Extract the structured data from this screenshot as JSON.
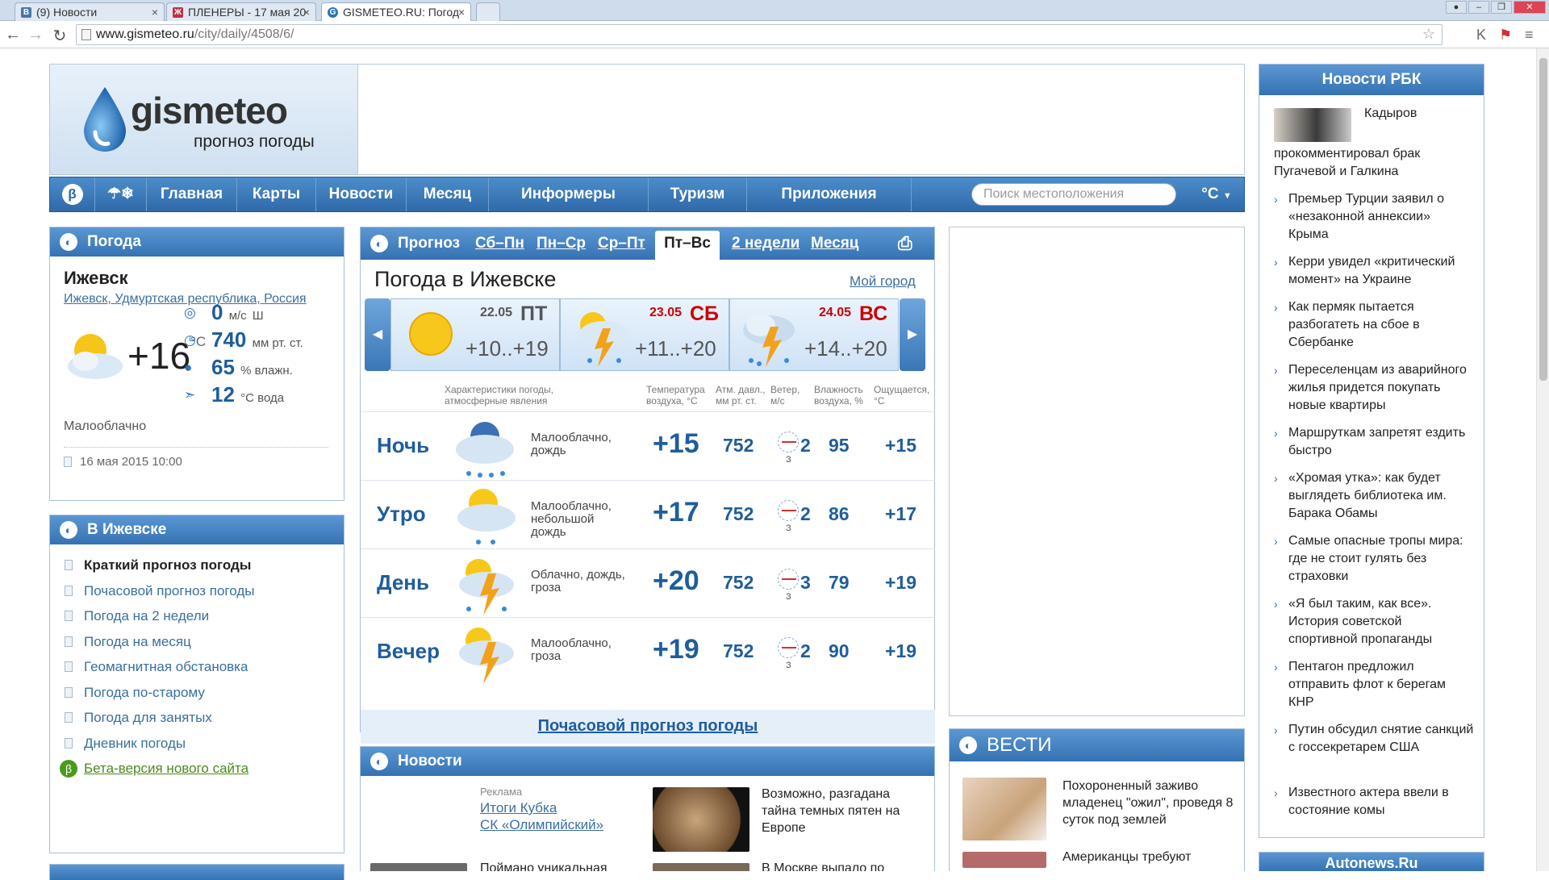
{
  "browser": {
    "tabs": [
      {
        "title": "(9) Новости",
        "favicon": "В"
      },
      {
        "title": "ПЛЕНЕРЫ - 17 мая 20",
        "favicon": "Ж"
      },
      {
        "title": "GISMETEO.RU: Погод",
        "favicon": "G"
      }
    ],
    "url_host": "www.gismeteo.ru",
    "url_path": "/city/daily/4508/6/"
  },
  "logo": {
    "name": "gismeteo",
    "tagline": "прогноз погоды"
  },
  "menu": {
    "items": [
      "Главная",
      "Карты",
      "Новости",
      "Месяц",
      "Информеры",
      "Туризм",
      "Приложения"
    ],
    "search_placeholder": "Поиск местоположения",
    "unit": "°C"
  },
  "weather_now": {
    "header": "Погода",
    "city": "Ижевск",
    "region_links": [
      "Ижевск",
      "Удмуртская республика",
      "Россия"
    ],
    "temp": "+16",
    "temp_unit": "°C",
    "condition": "Малооблачно",
    "wind_value": "0",
    "wind_unit": "м/с",
    "wind_dir": "Ш",
    "pressure_value": "740",
    "pressure_unit": "мм рт. ст.",
    "humidity_value": "65",
    "humidity_unit": "% влажн.",
    "water_value": "12",
    "water_unit": "°С вода",
    "observed": "16 мая 2015 10:00"
  },
  "in_city": {
    "header": "В Ижевске",
    "links": [
      "Краткий прогноз погоды",
      "Почасовой прогноз погоды",
      "Погода на 2 недели",
      "Погода на месяц",
      "Геомагнитная обстановка",
      "Погода по-старому",
      "Погода для занятых",
      "Дневник погоды"
    ],
    "beta": "Бета-версия нового сайта"
  },
  "forecast": {
    "header": "Прогноз",
    "tabs": [
      "Сб–Пн",
      "Пн–Ср",
      "Ср–Пт",
      "Пт–Вс",
      "2 недели",
      "Месяц"
    ],
    "title": "Погода в Ижевске",
    "my_city": "Мой город",
    "days": [
      {
        "date": "22.05",
        "name": "ПТ",
        "low": "+10",
        "high": "+19",
        "weekend": false,
        "icon": "sun-icon"
      },
      {
        "date": "23.05",
        "name": "СБ",
        "low": "+11",
        "high": "+20",
        "weekend": true,
        "icon": "thunderstorm-icon"
      },
      {
        "date": "24.05",
        "name": "ВС",
        "low": "+14",
        "high": "+20",
        "weekend": true,
        "icon": "thunderstorm-icon"
      }
    ],
    "columns": {
      "conditions": "Характеристики погоды, атмосферные явления",
      "temp": "Температура воздуха, °С",
      "pressure": "Атм. давл., мм рт. ст.",
      "wind": "Ветер, м/с",
      "humidity": "Влажность воздуха, %",
      "feels": "Ощущается, °С"
    },
    "rows": [
      {
        "period": "Ночь",
        "desc": "Малооблачно, дождь",
        "temp": "+15",
        "pressure": "752",
        "wind": "2",
        "wind_dir": "З",
        "humidity": "95",
        "feels": "+15"
      },
      {
        "period": "Утро",
        "desc": "Малооблачно, небольшой дождь",
        "temp": "+17",
        "pressure": "752",
        "wind": "2",
        "wind_dir": "З",
        "humidity": "86",
        "feels": "+17"
      },
      {
        "period": "День",
        "desc": "Облачно, дождь, гроза",
        "temp": "+20",
        "pressure": "752",
        "wind": "3",
        "wind_dir": "З",
        "humidity": "79",
        "feels": "+19"
      },
      {
        "period": "Вечер",
        "desc": "Малооблачно, гроза",
        "temp": "+19",
        "pressure": "752",
        "wind": "2",
        "wind_dir": "З",
        "humidity": "90",
        "feels": "+19"
      }
    ],
    "hourly_link": "Почасовой прогноз погоды"
  },
  "news": {
    "header": "Новости",
    "ad_label": "Реклама",
    "ad_links": [
      "Итоги Кубка",
      "СК «Олимпийский»"
    ],
    "story": "Возможно, разгадана тайна темных пятен на Европе",
    "more": [
      "Поймано уникальная",
      "В Москве выпало по"
    ]
  },
  "vesti": {
    "header": "ВЕСТИ",
    "story": "Похороненный заживо младенец \"ожил\", проведя 8 суток под землей",
    "more": "Американцы требуют"
  },
  "rbk": {
    "header": "Новости РБК",
    "lead_first": "Кадыров",
    "lead_rest": "прокомментировал брак Пугачевой и Галкина",
    "items": [
      "Премьер Турции заявил о «незаконной аннексии» Крыма",
      "Керри увидел «критический момент» на Украине",
      "Как пермяк пытается разбогатеть на сбое в Сбербанке",
      "Переселенцам из аварийного жилья придется покупать новые квартиры",
      "Маршруткам запретят ездить быстро",
      "«Хромая утка»: как будет выглядеть библиотека им. Барака Обамы",
      "Самые опасные тропы мира: где не стоит гулять без страховки",
      "«Я был таким, как все». История советской спортивной пропаганды",
      "Пентагон предложил отправить флот к берегам КНР",
      "Путин обсудил снятие санкций с госсекретарем США",
      "Известного актера ввели в состояние комы"
    ],
    "footer": "Autonews.Ru"
  },
  "colors": {
    "brand_blue": "#3572b2",
    "link": "#3a6fa0",
    "weekend_red": "#cc0000",
    "value_blue": "#1f5d9b"
  }
}
